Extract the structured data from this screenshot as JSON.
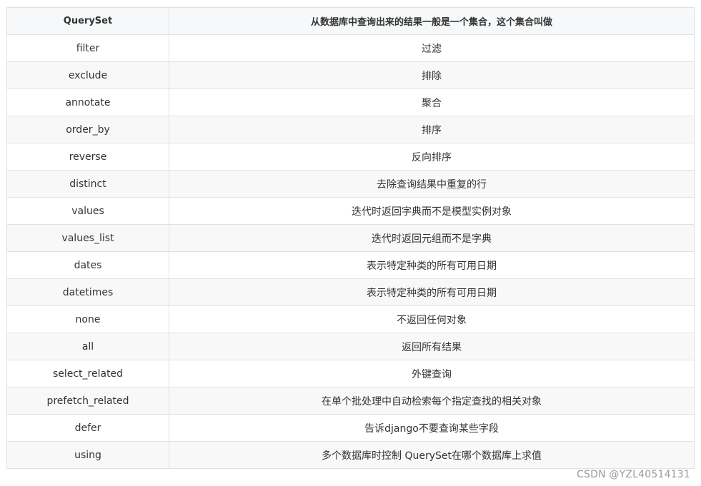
{
  "table": {
    "headers": [
      "QuerySet",
      "从数据库中查询出来的结果一般是一个集合，这个集合叫做"
    ],
    "rows": [
      [
        "filter",
        "过滤"
      ],
      [
        "exclude",
        "排除"
      ],
      [
        "annotate",
        "聚合"
      ],
      [
        "order_by",
        "排序"
      ],
      [
        "reverse",
        "反向排序"
      ],
      [
        "distinct",
        "去除查询结果中重复的行"
      ],
      [
        "values",
        "迭代时返回字典而不是模型实例对象"
      ],
      [
        "values_list",
        "迭代时返回元组而不是字典"
      ],
      [
        "dates",
        "表示特定种类的所有可用日期"
      ],
      [
        "datetimes",
        "表示特定种类的所有可用日期"
      ],
      [
        "none",
        "不返回任何对象"
      ],
      [
        "all",
        "返回所有结果"
      ],
      [
        "select_related",
        "外键查询"
      ],
      [
        "prefetch_related",
        "在单个批处理中自动检索每个指定查找的相关对象"
      ],
      [
        "defer",
        "告诉django不要查询某些字段"
      ],
      [
        "using",
        "多个数据库时控制 QuerySet在哪个数据库上求值"
      ]
    ]
  },
  "watermark": "CSDN @YZL40514131"
}
